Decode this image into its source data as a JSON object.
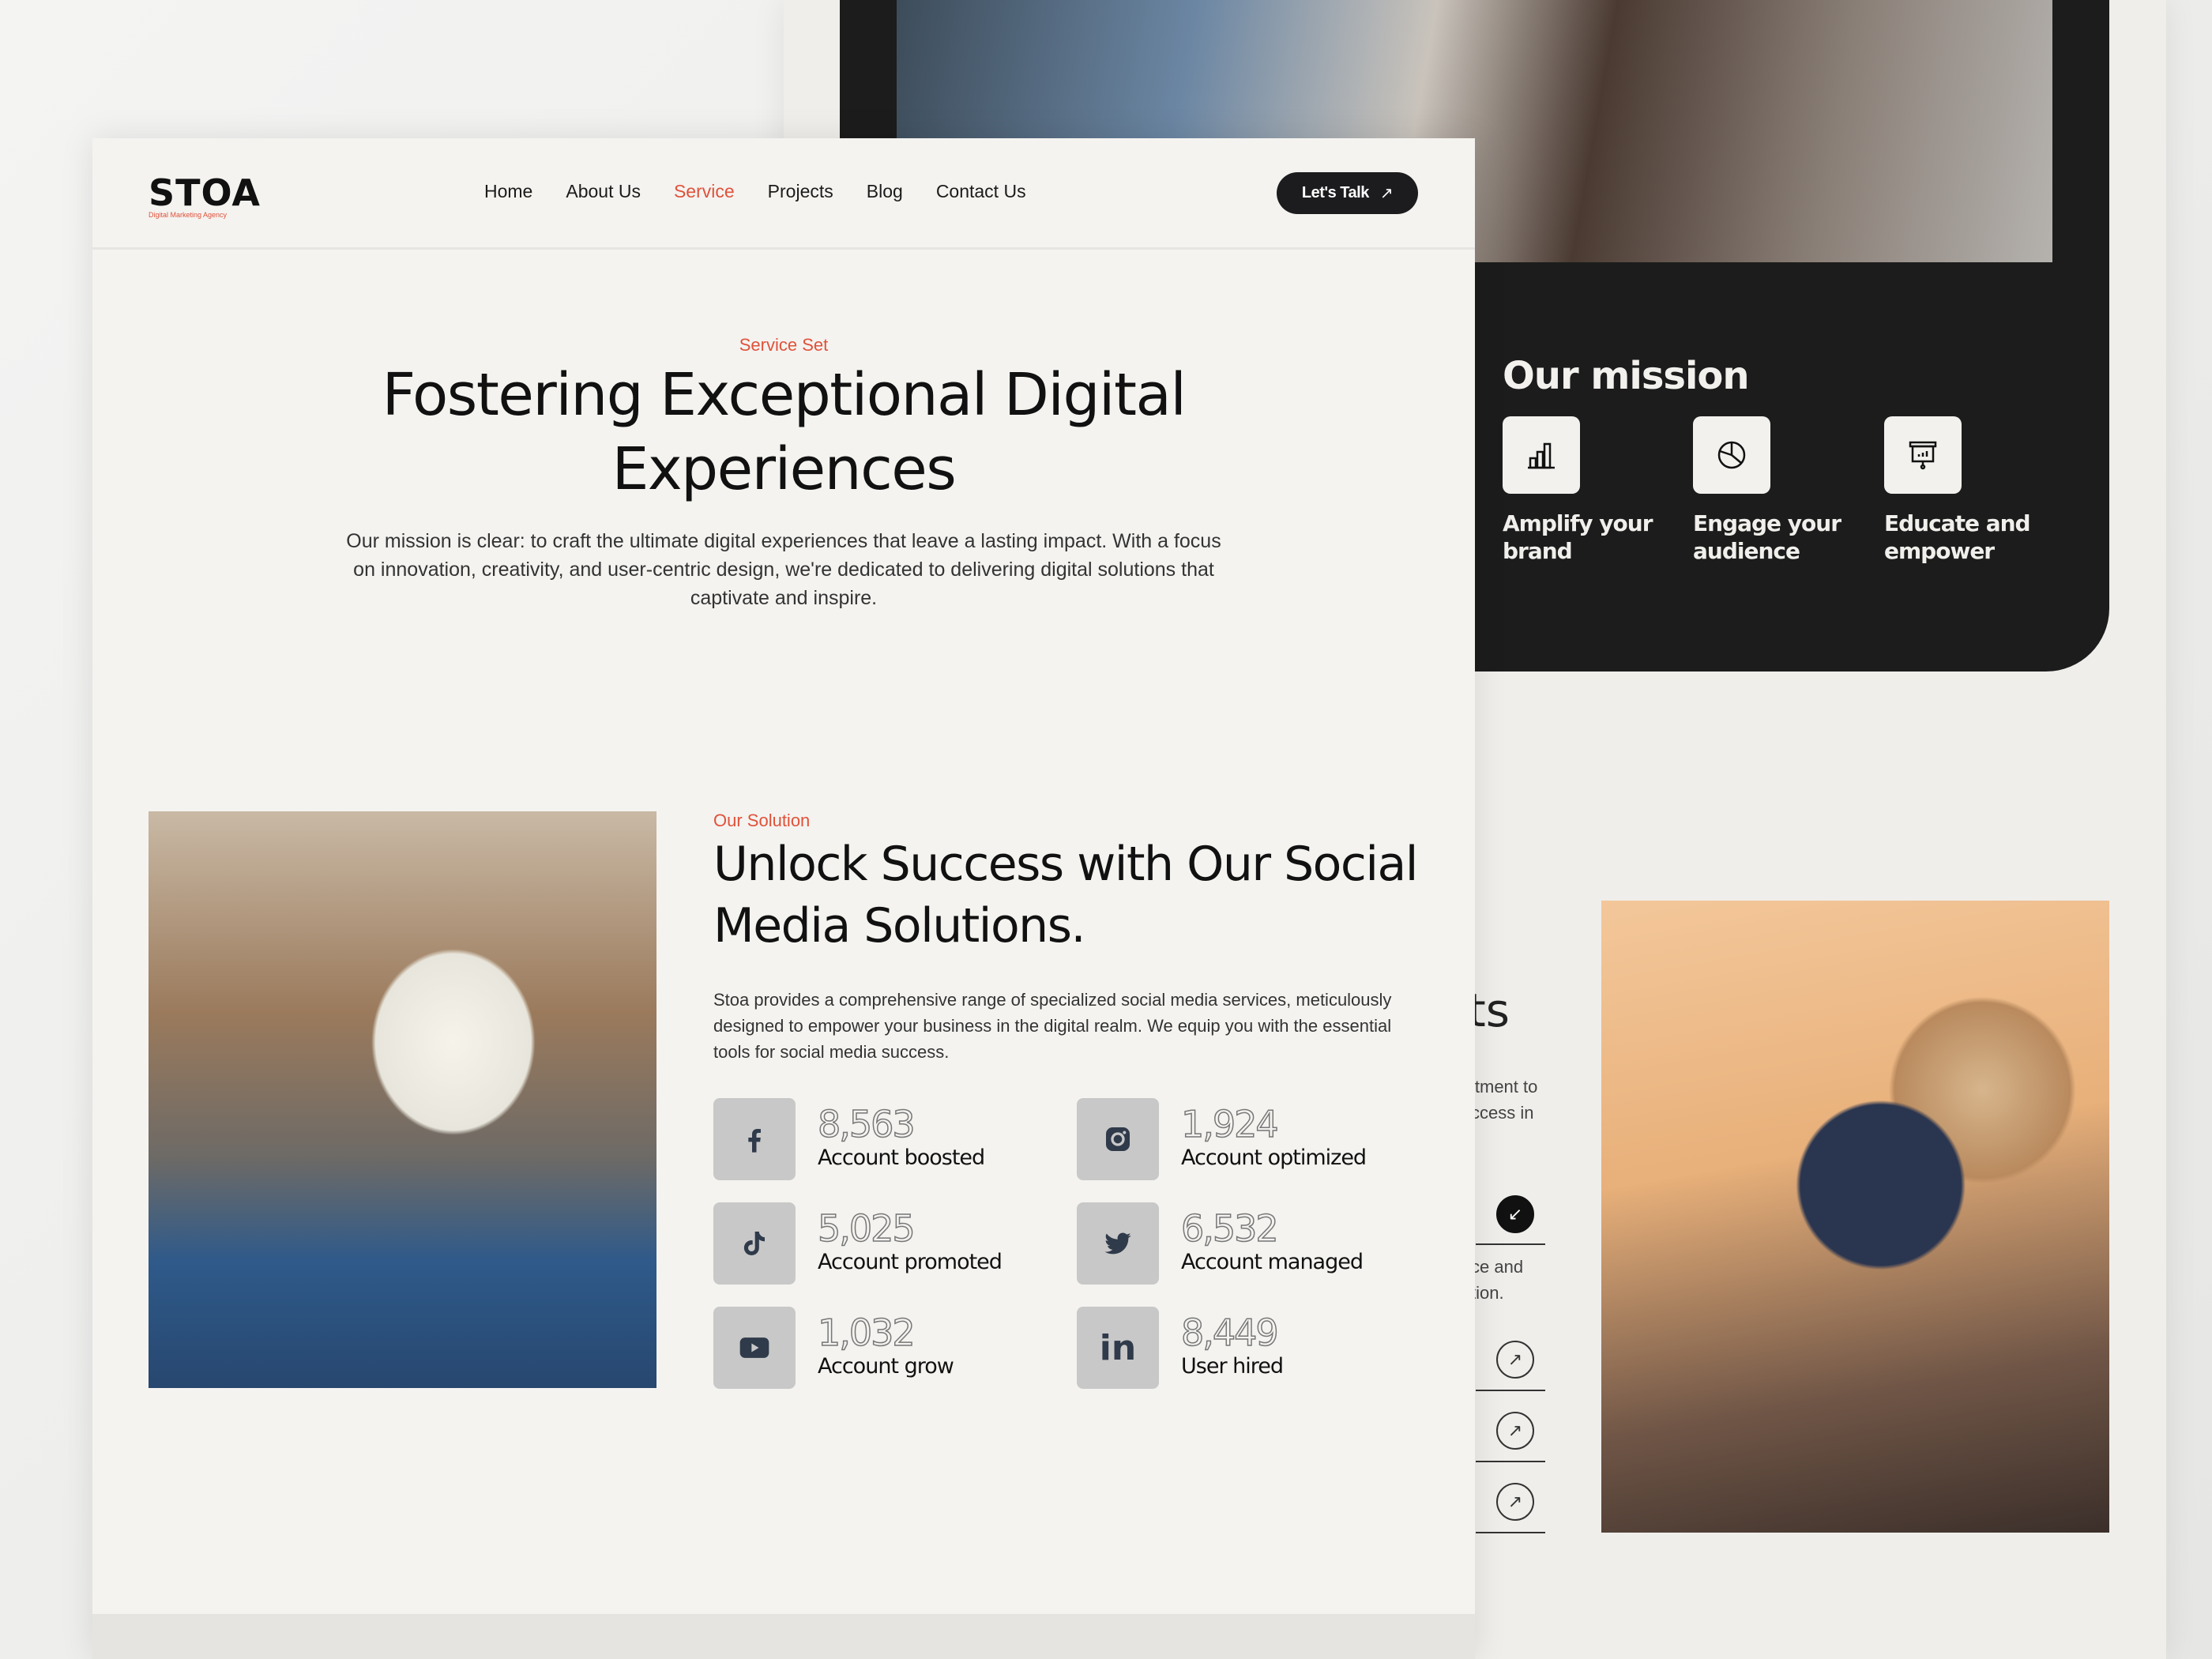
{
  "back_page": {
    "mission": {
      "title": "Our mission",
      "items": [
        {
          "icon": "bar-chart-icon",
          "label_1": "Amplify your",
          "label_2": "brand"
        },
        {
          "icon": "pie-chart-icon",
          "label_1": "Engage your",
          "label_2": "audience"
        },
        {
          "icon": "presentation-icon",
          "label_1": "Educate and",
          "label_2": "empower"
        }
      ]
    },
    "projects_fragment": {
      "heading": "ts",
      "line1": "itment to",
      "line2": "ccess in",
      "item_text1": "ce and",
      "item_text2": "tion."
    }
  },
  "header": {
    "logo": "STOA",
    "logo_tagline": "Digital Marketing Agency",
    "nav": [
      "Home",
      "About Us",
      "Service",
      "Projects",
      "Blog",
      "Contact Us"
    ],
    "active": "Service",
    "cta": "Let's Talk",
    "cta_icon": "↗"
  },
  "hero": {
    "eyebrow": "Service Set",
    "title_1": "Fostering Exceptional Digital",
    "title_2": "Experiences",
    "body": "Our mission is clear: to craft the ultimate digital experiences that leave a lasting impact. With a focus on innovation, creativity, and user-centric design, we're dedicated to delivering digital solutions that captivate and inspire."
  },
  "solution": {
    "eyebrow": "Our Solution",
    "title": "Unlock Success with Our Social Media Solutions.",
    "body": "Stoa provides a comprehensive range of specialized social media services, meticulously designed to empower your business in the digital realm. We equip you with the essential tools for social media success.",
    "stats": [
      {
        "icon": "facebook-icon",
        "value": "8,563",
        "label": "Account boosted"
      },
      {
        "icon": "instagram-icon",
        "value": "1,924",
        "label": "Account optimized"
      },
      {
        "icon": "tiktok-icon",
        "value": "5,025",
        "label": "Account promoted"
      },
      {
        "icon": "twitter-icon",
        "value": "6,532",
        "label": "Account managed"
      },
      {
        "icon": "youtube-icon",
        "value": "1,032",
        "label": "Account grow"
      },
      {
        "icon": "linkedin-icon",
        "value": "8,449",
        "label": "User hired"
      }
    ]
  },
  "colors": {
    "accent": "#e0523a",
    "dark": "#1c1c1c",
    "background": "#f4f3f0",
    "icon_tile": "#c8c8c8"
  }
}
